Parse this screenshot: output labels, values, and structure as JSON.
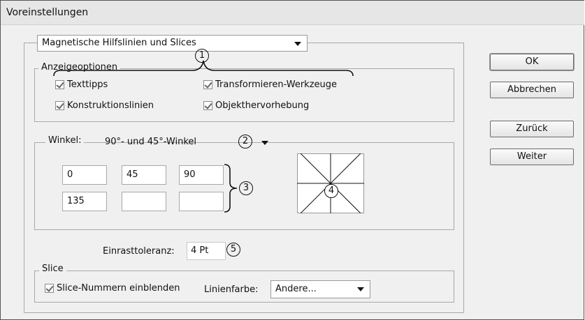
{
  "window": {
    "title": "Voreinstellungen"
  },
  "category": {
    "selected": "Magnetische Hilfslinien und Slices"
  },
  "display_options": {
    "legend": "Anzeigeoptionen",
    "texttips": "Texttipps",
    "construction_lines": "Konstruktionslinien",
    "transform_tools": "Transformieren-Werkzeuge",
    "object_highlighting": "Objekthervorhebung"
  },
  "angles": {
    "label": "Winkel:",
    "preset": "90°- und 45°-Winkel",
    "values": [
      "0",
      "45",
      "90",
      "135",
      "",
      ""
    ]
  },
  "snap": {
    "label": "Einrasttoleranz:",
    "value": "4 Pt"
  },
  "slice": {
    "legend": "Slice",
    "show_numbers": "Slice-Nummern einblenden",
    "line_color_label": "Linienfarbe:",
    "line_color_value": "Andere..."
  },
  "buttons": {
    "ok": "OK",
    "cancel": "Abbrechen",
    "back": "Zurück",
    "next": "Weiter"
  },
  "callouts": {
    "c1": "1",
    "c2": "2",
    "c3": "3",
    "c4": "4",
    "c5": "5"
  },
  "checkbox_states": {
    "texttips": true,
    "transform_tools": true,
    "construction_lines": true,
    "object_highlighting": true,
    "slice_numbers": true
  }
}
